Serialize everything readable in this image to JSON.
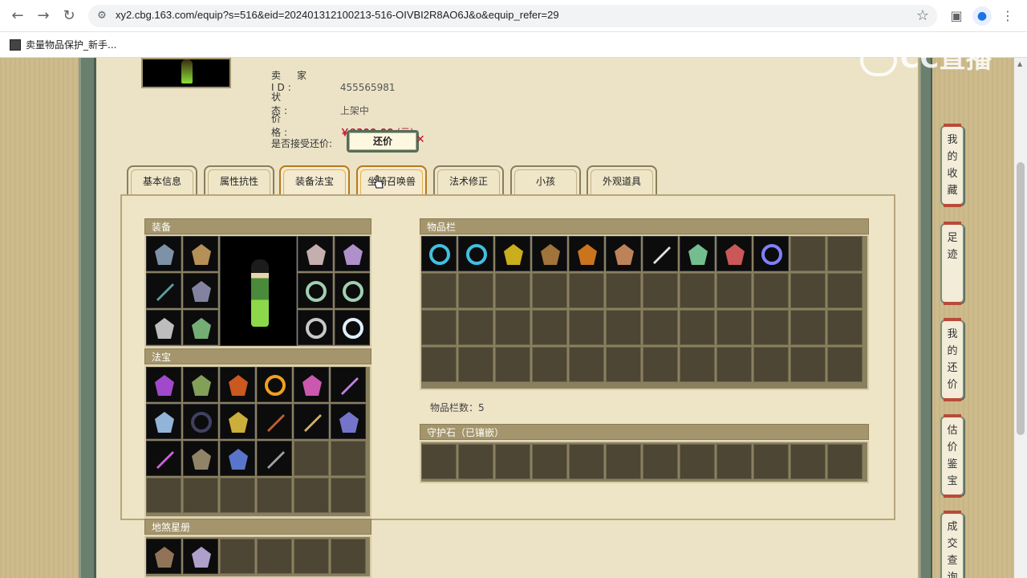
{
  "browser": {
    "url": "xy2.cbg.163.com/equip?s=516&eid=202401312100213-516-OIVBI2R8AO6J&o&equip_refer=29",
    "bookmark_label": "卖量物品保护_新手..."
  },
  "watermark": "CC直播",
  "seller": {
    "id_label": "卖　家　ID:",
    "id_value": "455565981",
    "status_label": "状　　　态:",
    "status_value": "上架中",
    "price_label": "价　　　格:",
    "price_value": "￥9300.00",
    "price_unit": "(元)",
    "bargain_label": "是否接受还价:",
    "bargain_button": "还价",
    "bargain_close": "✕"
  },
  "tabs": [
    {
      "label": "基本信息"
    },
    {
      "label": "属性抗性"
    },
    {
      "label": "装备法宝",
      "active": true
    },
    {
      "label": "坐骑召唤兽",
      "active": true
    },
    {
      "label": "法术修正"
    },
    {
      "label": "小孩"
    },
    {
      "label": "外观道具"
    }
  ],
  "sections": {
    "equipment": "装备",
    "fabao": "法宝",
    "star_book": "地煞星册",
    "inventory": "物品栏",
    "inventory_count": "物品栏数：5",
    "guard_stone": "守护石（已镶嵌）"
  },
  "side_buttons": [
    {
      "label": "我的收藏"
    },
    {
      "label": "足迹"
    },
    {
      "label": "我的还价"
    },
    {
      "label": "估价鉴宝"
    },
    {
      "label": "成交查询"
    }
  ],
  "colors": {
    "price": "#c8102e",
    "section_header": "#a4956c",
    "cell": "#4d4634",
    "active_tab_border": "#b57a1a"
  },
  "icons": {
    "equipment": [
      "cape-icon",
      "mask-crown-icon",
      "mask-icon",
      "necklace-icon",
      "blade-icon",
      "robe-icon",
      "gem-ring-icon",
      "gem-ring-icon",
      "pendant-icon",
      "boots-icon",
      "bracelet-icon",
      "orb-icon"
    ],
    "fabao": [
      "purple-fan-icon",
      "green-bell-icon",
      "orange-talisman-icon",
      "flame-orb-icon",
      "lantern-icon",
      "purple-wand-icon",
      "blue-scroll-icon",
      "dark-orb-icon",
      "golden-tower-icon",
      "flute-icon",
      "feather-icon",
      "book-icon",
      "purple-whip-icon",
      "box-icon",
      "blue-claw-icon",
      "grey-whip-icon"
    ],
    "inventory": [
      "blue-ring-icon",
      "blue-ring-icon",
      "gold-ribbon-icon",
      "figure-icon",
      "orange-boot-icon",
      "pendant-necklace-icon",
      "sword-icon",
      "green-cloak-icon",
      "red-necklace-icon",
      "purple-spirit-icon"
    ],
    "star_book": [
      "warrior-card-icon",
      "lady-card-icon"
    ]
  }
}
